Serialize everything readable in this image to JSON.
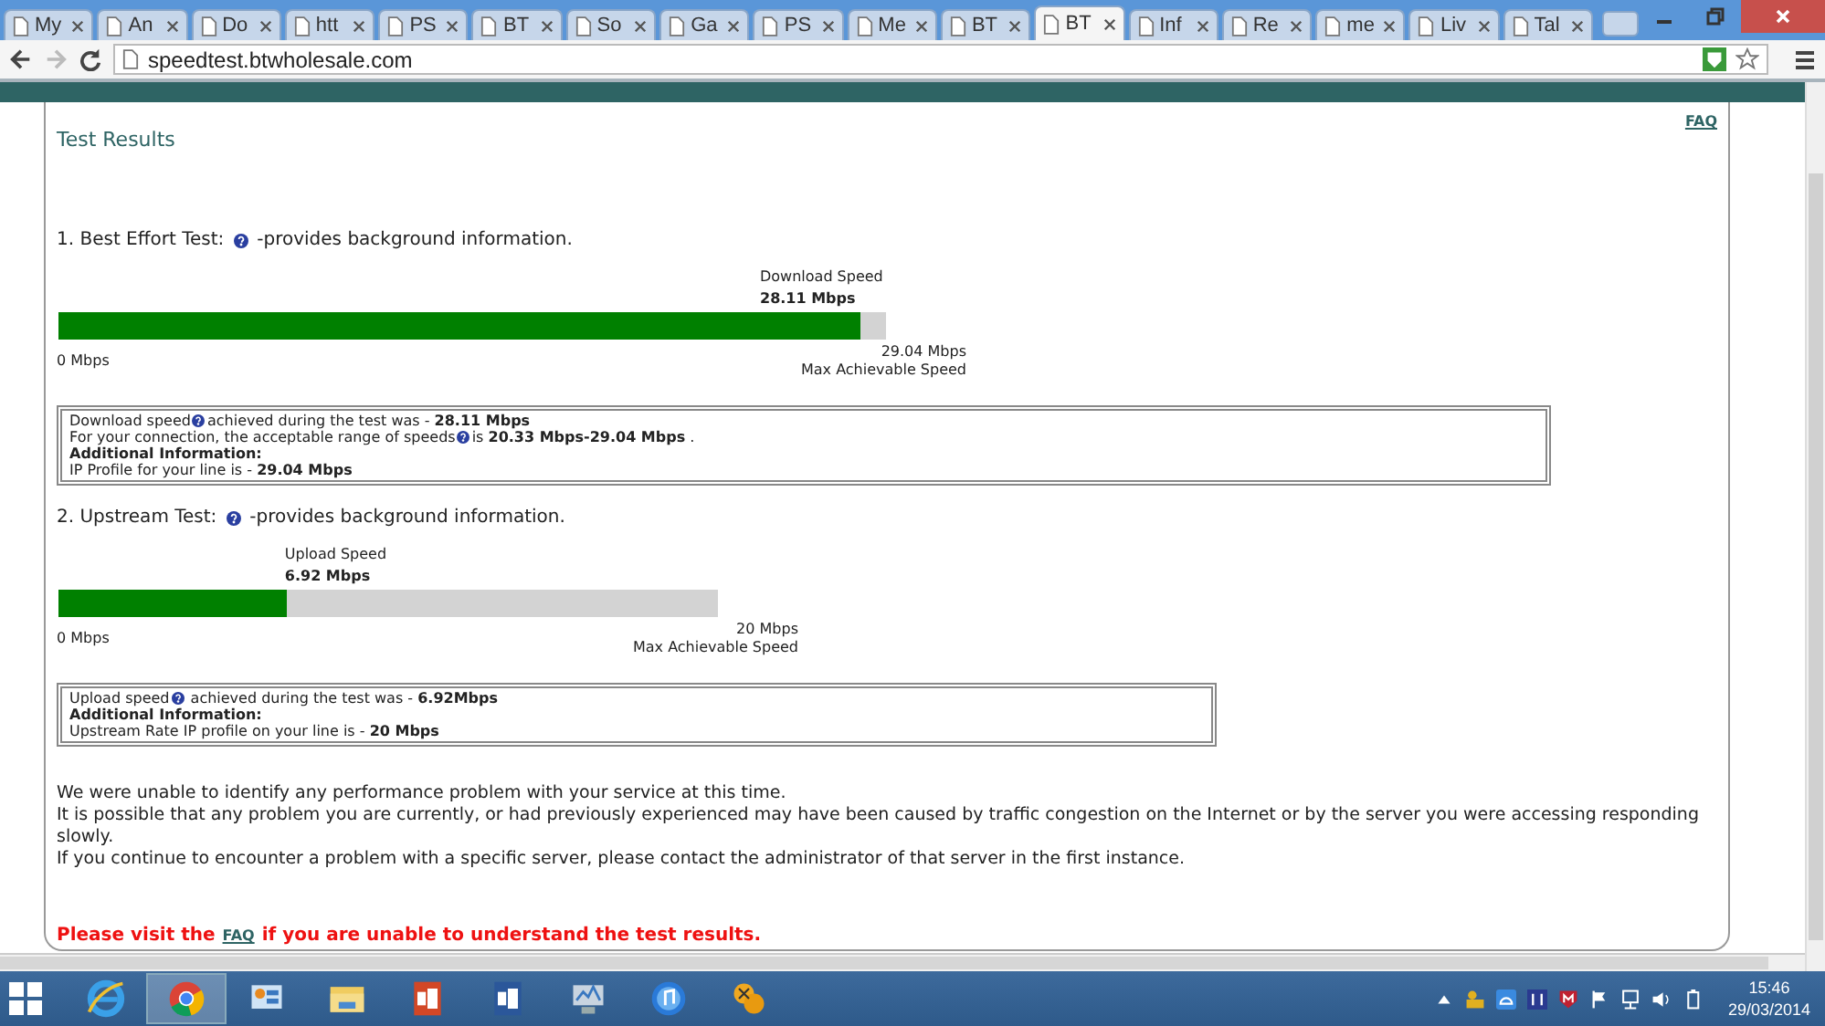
{
  "browser": {
    "tabs": [
      {
        "title": "My",
        "selected": false
      },
      {
        "title": "An",
        "selected": false
      },
      {
        "title": "Do",
        "selected": false
      },
      {
        "title": "htt",
        "selected": false
      },
      {
        "title": "PS",
        "selected": false
      },
      {
        "title": "BT",
        "selected": false
      },
      {
        "title": "So",
        "selected": false
      },
      {
        "title": "Ga",
        "selected": false
      },
      {
        "title": "PS",
        "selected": false
      },
      {
        "title": "Me",
        "selected": false
      },
      {
        "title": "BT",
        "selected": false
      },
      {
        "title": "BT",
        "selected": true
      },
      {
        "title": "Inf",
        "selected": false
      },
      {
        "title": "Re",
        "selected": false
      },
      {
        "title": "me",
        "selected": false
      },
      {
        "title": "Liv",
        "selected": false
      },
      {
        "title": "Tal",
        "selected": false
      }
    ],
    "url": "speedtest.btwholesale.com"
  },
  "page": {
    "title": "Test Results",
    "faq_link": "FAQ",
    "tests": [
      {
        "heading": "1. Best Effort Test:",
        "heading_note": "-provides background information.",
        "speed_label": "Download Speed",
        "speed_value": "28.11 Mbps",
        "level": 0.968,
        "min_label": "0 Mbps",
        "max_value": "29.04 Mbps",
        "max_label": "Max Achievable Speed",
        "info": [
          {
            "lead": "Download speed",
            "text": "achieved during the test was - **28.11 Mbps**"
          },
          {
            "lead": "For your connection, the acceptable range of speeds",
            "text": "is **20.33 Mbps-29.04 Mbps** ."
          },
          {
            "text": "**Additional Information:**"
          },
          {
            "text": "IP Profile for your line is - **29.04 Mbps**"
          }
        ]
      },
      {
        "heading": "2. Upstream Test:",
        "heading_note": "-provides background information.",
        "speed_label": "Upload Speed",
        "speed_value": "6.92 Mbps",
        "level": 0.346,
        "min_label": "0 Mbps",
        "max_value": "20 Mbps",
        "max_label": "Max Achievable Speed",
        "info": [
          {
            "lead": "Upload speed",
            "text": " achieved during the test was - **6.92Mbps**"
          },
          {
            "text": "**Additional Information:**"
          },
          {
            "text": "Upstream Rate IP profile on your line is - **20 Mbps**"
          }
        ]
      }
    ],
    "messages": [
      "We were unable to identify any performance problem with your service at this time.",
      "It is possible that any problem you are currently, or had previously experienced may have been caused by traffic congestion on the Internet or by the server you were accessing responding slowly.",
      "If you continue to encounter a problem with a specific server, please contact the administrator of that server in the first instance."
    ],
    "notice_before": "Please visit the",
    "notice_link": "FAQ",
    "notice_after": "if you are unable to understand the test results."
  },
  "taskbar": {
    "apps": [
      {
        "selected": false
      },
      {
        "selected": true
      },
      {
        "selected": false
      },
      {
        "selected": false
      },
      {
        "selected": false
      },
      {
        "selected": false
      },
      {
        "selected": false
      },
      {
        "selected": false
      },
      {
        "selected": false
      }
    ],
    "time": "15:46",
    "date": "29/03/2014"
  }
}
